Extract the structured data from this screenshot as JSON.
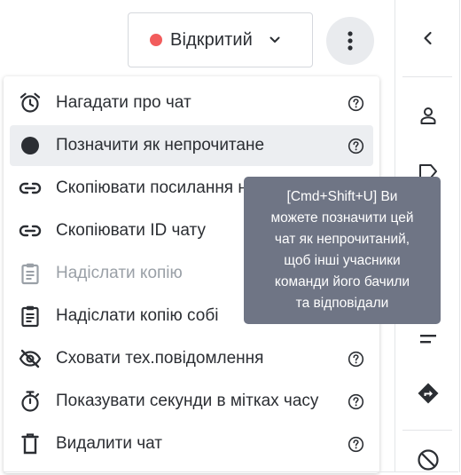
{
  "status": {
    "label": "Відкритий",
    "dot_color": "#f25c5c"
  },
  "menu": {
    "items": [
      {
        "label": "Нагадати про чат",
        "icon": "alarm-clock-icon",
        "help": true
      },
      {
        "label": "Позначити як непрочитане",
        "icon": "filled-circle-icon",
        "help": true,
        "active": true
      },
      {
        "label": "Скопіювати посилання на чат",
        "icon": "link-icon"
      },
      {
        "label": "Скопіювати ID чату",
        "icon": "link-icon"
      },
      {
        "label": "Надіслати копію",
        "icon": "clipboard-icon",
        "disabled": true
      },
      {
        "label": "Надіслати копію собі",
        "icon": "clipboard-icon"
      },
      {
        "label": "Сховати тех.повідомлення",
        "icon": "eye-off-icon",
        "help": true
      },
      {
        "label": "Показувати секунди в мітках часу",
        "icon": "stopwatch-icon",
        "help": true
      },
      {
        "label": "Видалити чат",
        "icon": "trash-icon",
        "help": true
      }
    ]
  },
  "tooltip": {
    "lines": [
      "[Cmd+Shift+U] Ви",
      "можете позначити цей",
      "чат як непрочитаний,",
      "щоб інші учасники",
      "команди його бачили",
      "та відповідали"
    ]
  },
  "sidebar": {
    "icons": [
      "chevron-left-icon",
      "person-icon",
      "tag-icon",
      "text-align-icon",
      "directions-icon",
      "block-icon"
    ]
  },
  "colors": {
    "text": "#2b2e33",
    "disabled_text": "#9aa0a7",
    "tooltip_bg": "#6f7585",
    "active_row": "#eceef1",
    "status_dot": "#f25c5c"
  }
}
